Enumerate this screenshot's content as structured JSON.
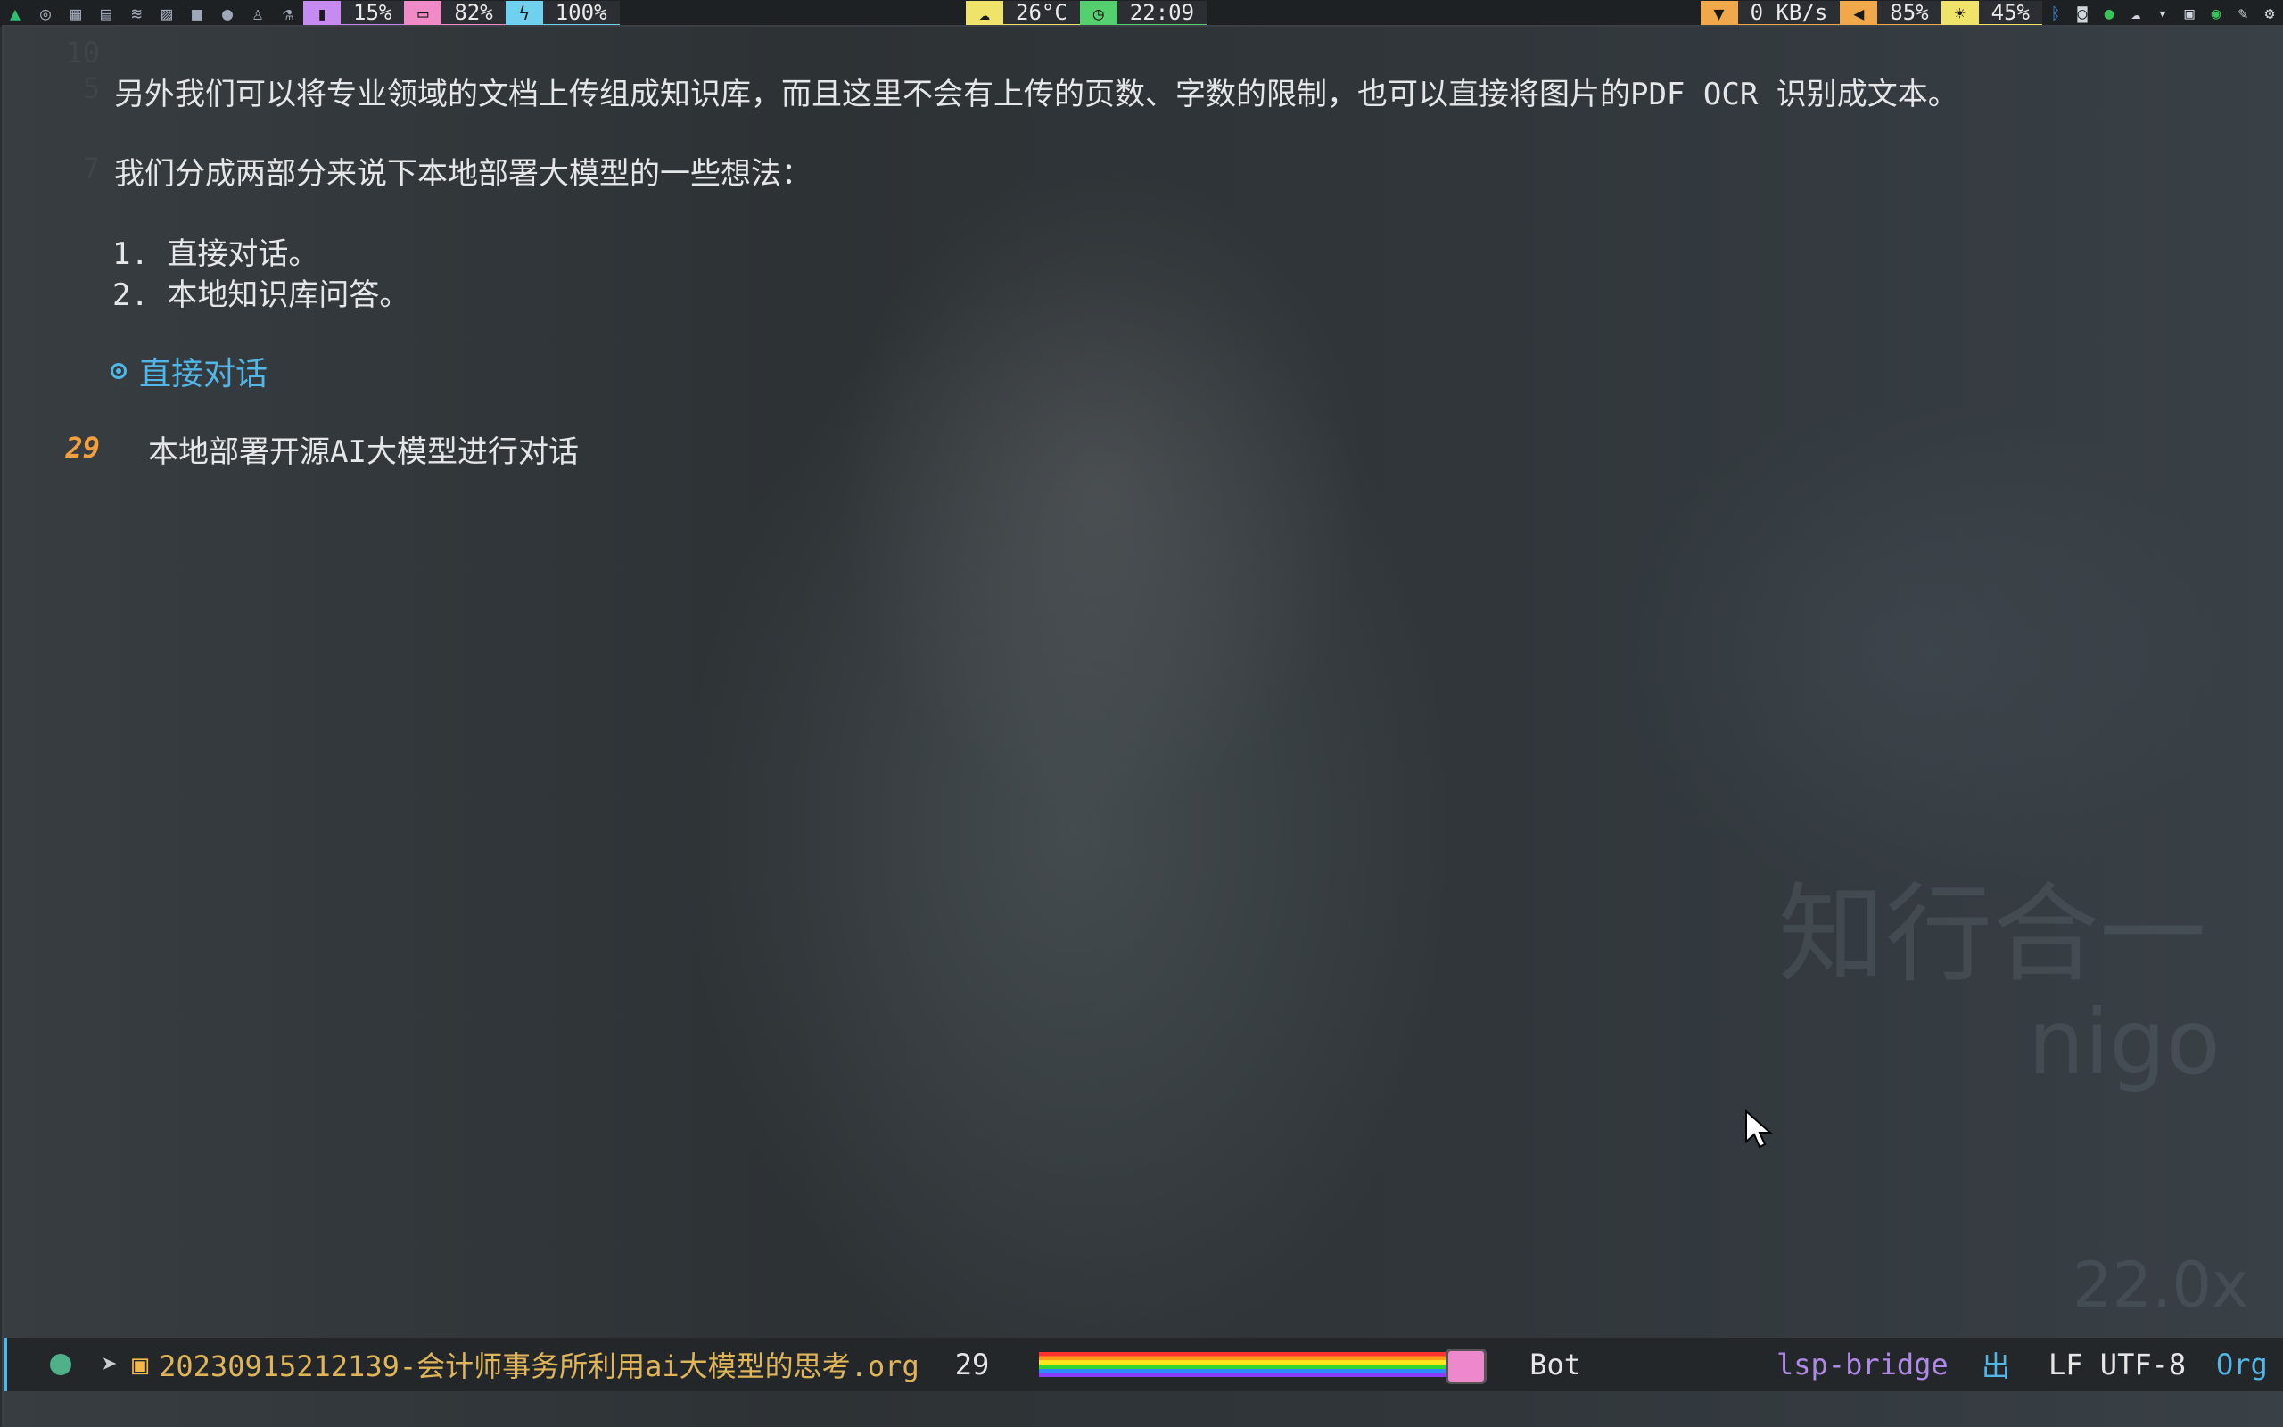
{
  "topbar": {
    "app_icons": [
      "arch-icon",
      "chrome-icon",
      "excel-icon",
      "word-icon",
      "database-icon",
      "image-icon",
      "video-icon",
      "wechat-icon",
      "linux-icon",
      "flask-icon"
    ],
    "cpu": {
      "value": "15%",
      "color": "#c58bf0"
    },
    "mem": {
      "value": "82%",
      "color": "#f08bc8"
    },
    "battery": {
      "value": "100%",
      "color": "#6fd0f0"
    },
    "weather": {
      "value": "26°C",
      "color": "#f0e36a"
    },
    "clock": {
      "value": "22:09",
      "color": "#55d06f"
    },
    "network": {
      "value": "0 KB/s",
      "color": "#f0a84a"
    },
    "volume": {
      "value": "85%",
      "color": "#f0a84a"
    },
    "brightness": {
      "value": "45%",
      "color": "#f0e36a"
    }
  },
  "editor": {
    "lines": [
      {
        "no": "10",
        "text": ""
      },
      {
        "no": "5",
        "text": "另外我们可以将专业领域的文档上传组成知识库，而且这里不会有上传的页数、字数的限制，也可以直接将图片的PDF OCR 识别成文本。"
      },
      {
        "no": "7",
        "text": "我们分成两部分来说下本地部署大模型的一些想法："
      },
      {
        "no": "",
        "text": "1. 直接对话。"
      },
      {
        "no": "",
        "text": "2. 本地知识库问答。"
      }
    ],
    "heading": "直接对话",
    "current_line_no": "29",
    "current_line_text": "本地部署开源AI大模型进行对话"
  },
  "modeline": {
    "filename": "20230915212139-会计师事务所利用ai大模型的思考.org",
    "line": "29",
    "position": "Bot",
    "lsp": "lsp-bridge",
    "icon": "出",
    "encoding": "LF UTF-8",
    "mode": "Org"
  },
  "watermark": {
    "line1": "知行合一",
    "line2": "nigo",
    "line3": "22.0x"
  }
}
